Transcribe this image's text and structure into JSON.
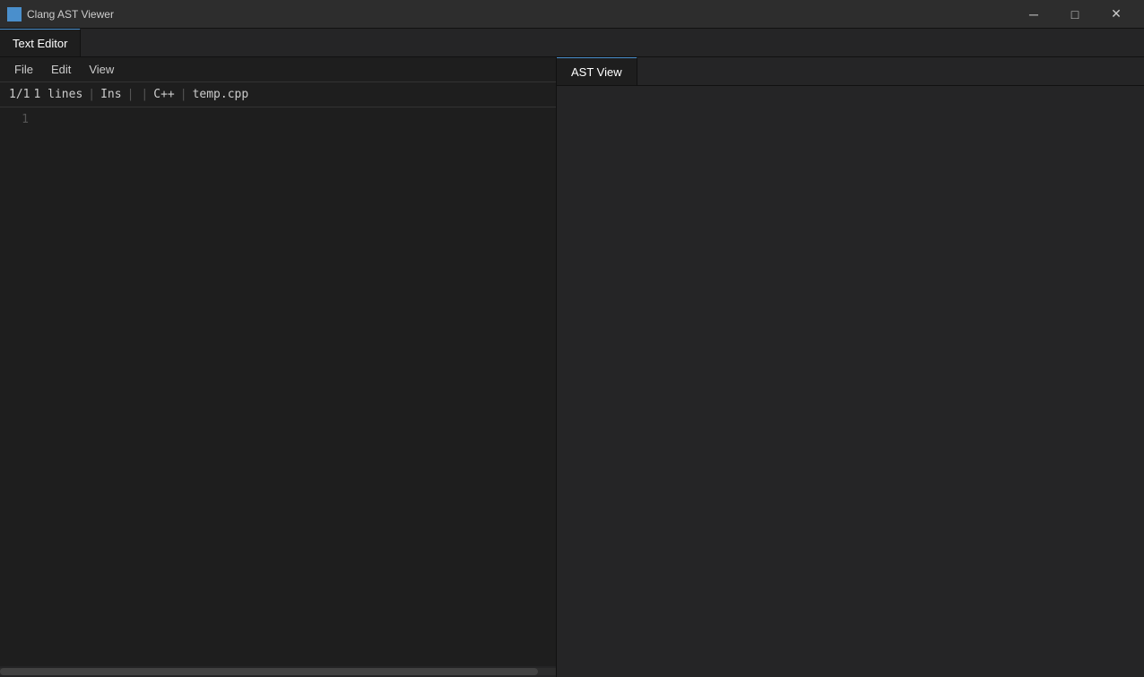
{
  "titlebar": {
    "icon_label": "■",
    "title": "Clang AST Viewer",
    "minimize_label": "─",
    "maximize_label": "□",
    "close_label": "✕"
  },
  "tabs": {
    "text_editor": {
      "label": "Text Editor",
      "active": true
    }
  },
  "ast_panel": {
    "tab_label": "AST View"
  },
  "menu": {
    "file": "File",
    "edit": "Edit",
    "view": "View"
  },
  "status": {
    "position": "1/1",
    "lines": "1 lines",
    "sep1": "|",
    "mode": "Ins",
    "sep2": "|",
    "sep3": "|",
    "language": "C++",
    "sep4": "|",
    "filename": "temp.cpp"
  },
  "editor": {
    "line_number": "1",
    "placeholder": ""
  }
}
